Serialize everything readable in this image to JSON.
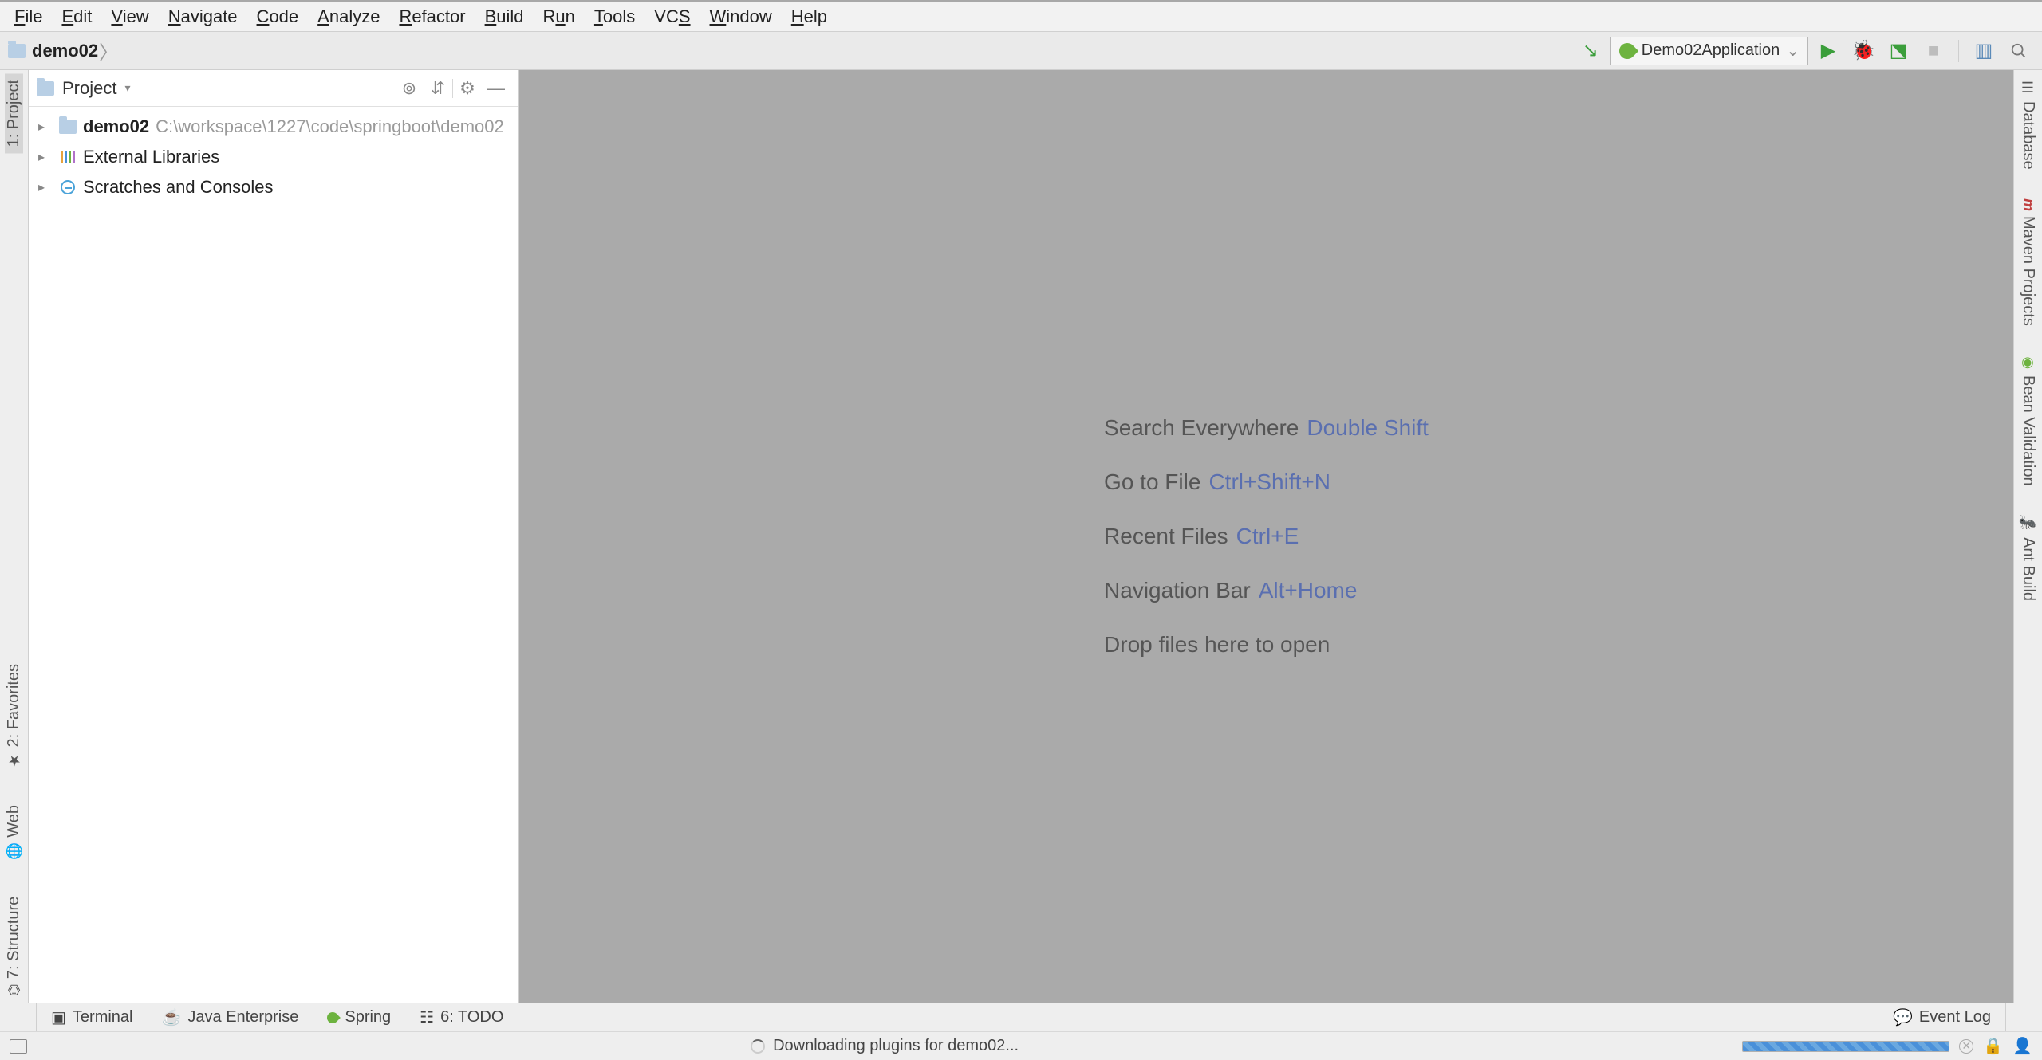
{
  "menubar": {
    "items": [
      {
        "label": "File",
        "u": "F"
      },
      {
        "label": "Edit",
        "u": "E"
      },
      {
        "label": "View",
        "u": "V"
      },
      {
        "label": "Navigate",
        "u": "N"
      },
      {
        "label": "Code",
        "u": "C"
      },
      {
        "label": "Analyze",
        "u": "A"
      },
      {
        "label": "Refactor",
        "u": "R"
      },
      {
        "label": "Build",
        "u": "B"
      },
      {
        "label": "Run",
        "u": "u"
      },
      {
        "label": "Tools",
        "u": "T"
      },
      {
        "label": "VCS",
        "u": "S"
      },
      {
        "label": "Window",
        "u": "W"
      },
      {
        "label": "Help",
        "u": "H"
      }
    ]
  },
  "navbar": {
    "breadcrumb": "demo02",
    "run_config": "Demo02Application"
  },
  "left_rail": {
    "items": [
      {
        "label": "1: Project"
      },
      {
        "label": "2: Favorites"
      },
      {
        "label": "Web"
      },
      {
        "label": "7: Structure"
      }
    ]
  },
  "project_panel": {
    "title": "Project",
    "tree": [
      {
        "name": "demo02",
        "path": "C:\\workspace\\1227\\code\\springboot\\demo02",
        "bold": true,
        "icon": "folder"
      },
      {
        "name": "External Libraries",
        "icon": "libs"
      },
      {
        "name": "Scratches and Consoles",
        "icon": "scratch"
      }
    ]
  },
  "editor_tips": [
    {
      "text": "Search Everywhere",
      "shortcut": "Double Shift"
    },
    {
      "text": "Go to File",
      "shortcut": "Ctrl+Shift+N"
    },
    {
      "text": "Recent Files",
      "shortcut": "Ctrl+E"
    },
    {
      "text": "Navigation Bar",
      "shortcut": "Alt+Home"
    },
    {
      "text": "Drop files here to open",
      "shortcut": ""
    }
  ],
  "right_rail": {
    "items": [
      {
        "label": "Database"
      },
      {
        "label": "Maven Projects"
      },
      {
        "label": "Bean Validation"
      },
      {
        "label": "Ant Build"
      }
    ]
  },
  "bottom_tools": {
    "items": [
      {
        "label": "Terminal"
      },
      {
        "label": "Java Enterprise"
      },
      {
        "label": "Spring"
      },
      {
        "label": "6: TODO"
      }
    ],
    "event_log": "Event Log"
  },
  "status": {
    "message": "Downloading plugins for demo02..."
  }
}
